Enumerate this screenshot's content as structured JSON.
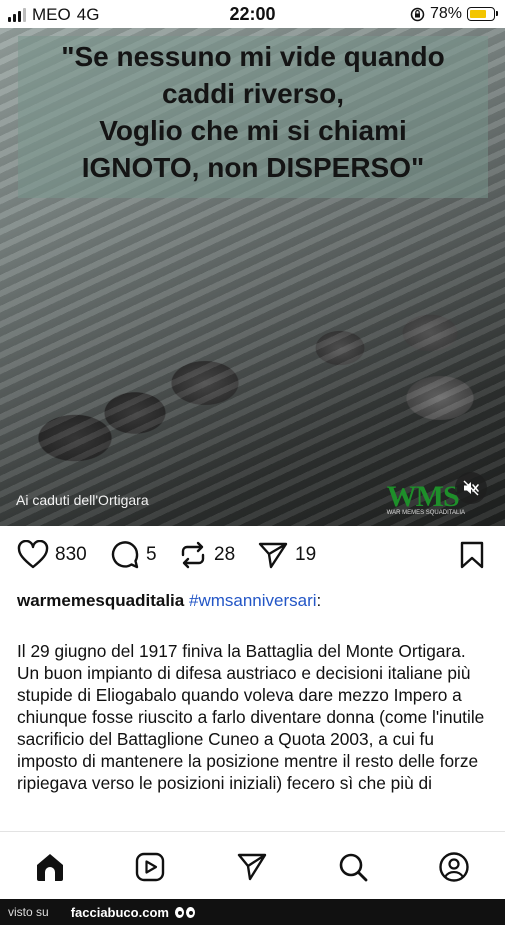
{
  "status_bar": {
    "carrier": "MEO",
    "network": "4G",
    "time": "22:00",
    "battery_percent": "78%",
    "battery_level": 0.78,
    "battery_color": "#f3c500"
  },
  "post": {
    "image": {
      "quote_lines": [
        "\"Se nessuno mi vide quando",
        "caddi riverso,",
        "Voglio che mi si chiami",
        "IGNOTO, non DISPERSO\""
      ],
      "caption": "Ai caduti dell'Ortigara",
      "watermark": "WMS",
      "watermark_sub": "WAR MEMES SQUADITALIA",
      "mute_icon": "speaker-muted-icon"
    },
    "actions": {
      "likes": "830",
      "comments": "5",
      "reposts": "28",
      "shares": "19",
      "icons": [
        "heart-icon",
        "comment-icon",
        "repost-icon",
        "send-icon",
        "bookmark-icon"
      ]
    },
    "username": "warmemesquaditalia",
    "hashtag": "#wmsanniversari",
    "hashtag_suffix": ":",
    "hashtag_color": "#2356c6",
    "paragraph_1": "Il 29 giugno del 1917  finiva la Battaglia del Monte Ortigara.",
    "paragraph_2": "Un buon impianto di difesa austriaco e decisioni italiane più stupide di Eliogabalo quando voleva dare mezzo Impero a chiunque fosse riuscito a farlo diventare donna (come l'inutile sacrificio del Battaglione Cuneo a Quota 2003, a cui fu imposto di mantenere la posizione mentre il resto delle forze ripiegava verso le posizioni iniziali) fecero sì che più di"
  },
  "bottom_nav": {
    "items": [
      "home-icon",
      "reels-icon",
      "explore-icon",
      "search-icon",
      "profile-icon"
    ]
  },
  "footer": {
    "prefix": "visto su",
    "site": "facciabuco.com"
  }
}
